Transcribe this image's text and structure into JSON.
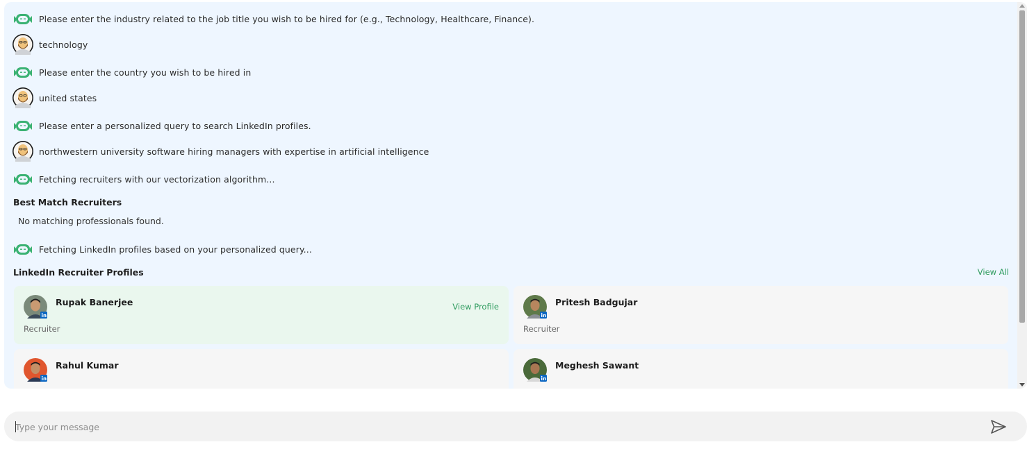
{
  "chat": {
    "messages": [
      {
        "sender": "bot",
        "text": "Please enter the industry related to the job title you wish to be hired for (e.g., Technology, Healthcare, Finance)."
      },
      {
        "sender": "user",
        "text": "technology"
      },
      {
        "sender": "bot",
        "text": "Please enter the country you wish to be hired in"
      },
      {
        "sender": "user",
        "text": "united states"
      },
      {
        "sender": "bot",
        "text": "Please enter a personalized query to search LinkedIn profiles."
      },
      {
        "sender": "user",
        "text": "northwestern university software hiring managers with expertise in artificial intelligence"
      },
      {
        "sender": "bot",
        "text": "Fetching recruiters with our vectorization algorithm..."
      },
      {
        "sender": "bot",
        "text": "Fetching LinkedIn profiles based on your personalized query..."
      }
    ],
    "best_match": {
      "title": "Best Match Recruiters",
      "empty_text": "No matching professionals found."
    },
    "linkedin": {
      "title": "LinkedIn Recruiter Profiles",
      "view_all": "View All",
      "view_profile": "View Profile",
      "profiles": [
        {
          "name": "Rupak Banerjee",
          "role": "Recruiter"
        },
        {
          "name": "Pritesh Badgujar",
          "role": "Recruiter"
        },
        {
          "name": "Rahul Kumar",
          "role": ""
        },
        {
          "name": "Meghesh Sawant",
          "role": ""
        }
      ]
    }
  },
  "input": {
    "placeholder": "Type your message",
    "send_icon": "send-icon"
  },
  "colors": {
    "panel_bg": "#eef6ff",
    "bot_green": "#3bb273",
    "link_green": "#2e9b5e",
    "card_highlight": "#eaf7ee",
    "card_bg": "#f6f6f6"
  }
}
